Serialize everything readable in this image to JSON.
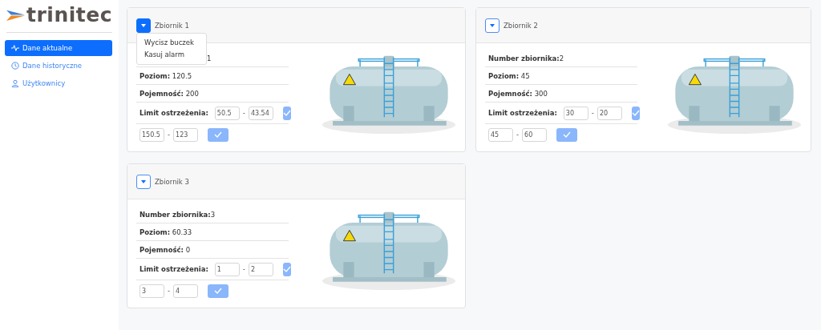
{
  "logo": {
    "text": "trinitec"
  },
  "sidebar": {
    "items": [
      {
        "label": "Dane aktualne",
        "selected": true
      },
      {
        "label": "Dane historyczne",
        "selected": false
      },
      {
        "label": "Użytkownicy",
        "selected": false
      }
    ]
  },
  "tanks": [
    {
      "title": "Zbiornik 1",
      "menu_open": true,
      "menu_items": [
        "Wycisz buczek",
        "Kasuj alarm"
      ],
      "number": "1",
      "level_label": "Poziom:",
      "level_value": "120.5",
      "capacity_label": "Pojemność:",
      "capacity_value": "200",
      "limit_label": "Limit ostrzeżenia:",
      "limits": [
        {
          "low": "50.5",
          "high": "43.54"
        },
        {
          "low": "150.5",
          "high": "123"
        }
      ],
      "separator": "-"
    },
    {
      "title": "Zbiornik 2",
      "menu_open": false,
      "number_label": "Number zbiornika:",
      "number": "2",
      "level_label": "Poziom:",
      "level_value": "45",
      "capacity_label": "Pojemność:",
      "capacity_value": "300",
      "limit_label": "Limit ostrzeżenia:",
      "limits": [
        {
          "low": "30",
          "high": "20"
        },
        {
          "low": "45",
          "high": "60"
        }
      ],
      "separator": "-"
    },
    {
      "title": "Zbiornik 3",
      "menu_open": false,
      "number_label": "Number zbiornika:",
      "number": "3",
      "level_label": "Poziom:",
      "level_value": "60.33",
      "capacity_label": "Pojemność:",
      "capacity_value": "0",
      "limit_label": "Limit ostrzeżenia:",
      "limits": [
        {
          "low": "1",
          "high": "2"
        },
        {
          "low": "3",
          "high": "4"
        }
      ],
      "separator": "-"
    }
  ]
}
